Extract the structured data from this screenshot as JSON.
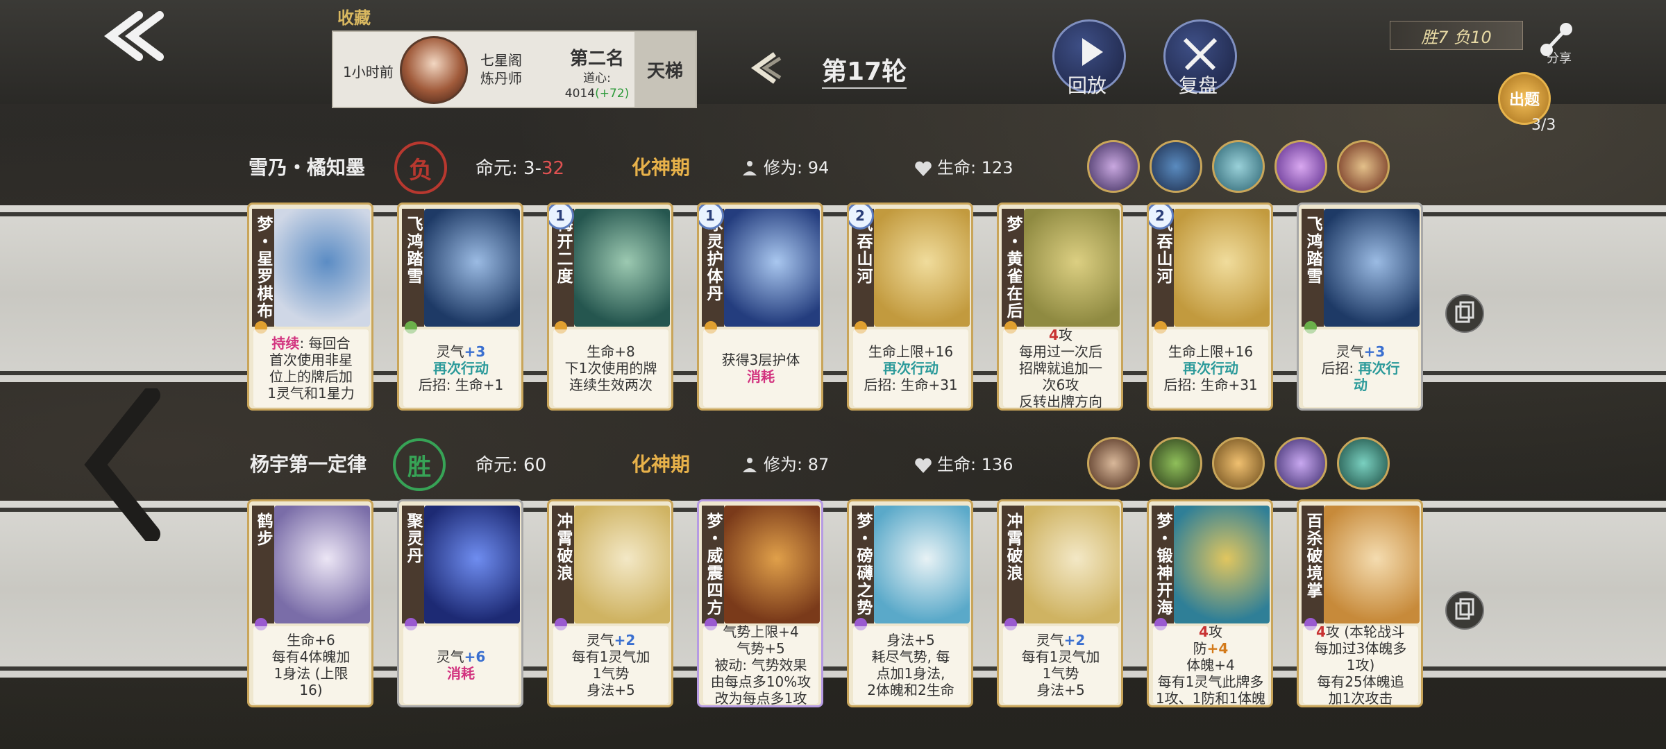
{
  "header": {
    "collect_label": "收藏",
    "record": {
      "time": "1小时前",
      "sect": "七星阁",
      "title": "炼丹师",
      "rank": "第二名",
      "daoxin_label": "道心:",
      "daoxin_value": "4014",
      "daoxin_gain": "(+72)",
      "ladder": "天梯"
    },
    "round_label": "第17轮",
    "replay_label": "回放",
    "review_label": "复盘",
    "win_loss": "胜7 负10",
    "share_label": "分享",
    "quiz_label": "出题",
    "quiz_count": "3/3"
  },
  "players": [
    {
      "name": "雪乃・橘知墨",
      "result": "负",
      "life_label": "命元:",
      "life_value": "3-",
      "life_loss": "32",
      "realm": "化神期",
      "cultivation": "修为: 94",
      "hp": "生命: 123",
      "portraits": [
        "portrait-1",
        "portrait-2",
        "portrait-3",
        "portrait-4",
        "portrait-5"
      ],
      "cards": [
        {
          "title": "梦・星罗棋布",
          "level": "",
          "lines": [
            {
              "t": "持续",
              "c": "pink",
              "rest": ": 每回合"
            },
            {
              "t": "首次使用非星"
            },
            {
              "t": "位上的牌后加"
            },
            {
              "t": "1灵气和1星力"
            }
          ],
          "art": [
            "#cfd7e6",
            "#5b8cc4"
          ],
          "frame": "gold"
        },
        {
          "title": "飞鸿踏雪",
          "level": "",
          "lines": [
            {
              "t": "灵气",
              "rest2": "+3",
              "c2": "blue"
            },
            {
              "t": "再次行动",
              "c": "teal"
            },
            {
              "t": "后招: 生命+1"
            }
          ],
          "art": [
            "#1e3a66",
            "#9bbbe3"
          ],
          "frame": "gold"
        },
        {
          "title": "梅开二度",
          "level": "1",
          "lines": [
            {
              "t": "生命+8"
            },
            {
              "t": "下1次使用的牌"
            },
            {
              "t": "连续生效两次"
            }
          ],
          "art": [
            "#25564f",
            "#9cc9b1"
          ],
          "frame": "gold"
        },
        {
          "title": "冰灵护体丹",
          "level": "1",
          "lines": [
            {
              "t": "获得3层护体"
            },
            {
              "t": "消耗",
              "c": "pink"
            }
          ],
          "art": [
            "#243d7e",
            "#a9c7ef"
          ],
          "frame": "gold"
        },
        {
          "title": "气吞山河",
          "level": "2",
          "lines": [
            {
              "t": "生命上限+16"
            },
            {
              "t": "再次行动",
              "c": "teal"
            },
            {
              "t": "后招: 生命+31"
            }
          ],
          "art": [
            "#c29a3e",
            "#f0dc9c"
          ],
          "frame": "gold"
        },
        {
          "title": "梦・黄雀在后",
          "level": "",
          "lines": [
            {
              "t": "4",
              "c": "red",
              "rest": "攻"
            },
            {
              "t": "每用过一次后"
            },
            {
              "t": "招牌就追加一"
            },
            {
              "t": "次6攻"
            },
            {
              "t": "反转出牌方向"
            }
          ],
          "art": [
            "#8f8a41",
            "#dccf82"
          ],
          "frame": "gold"
        },
        {
          "title": "气吞山河",
          "level": "2",
          "lines": [
            {
              "t": "生命上限+16"
            },
            {
              "t": "再次行动",
              "c": "teal"
            },
            {
              "t": "后招: 生命+31"
            }
          ],
          "art": [
            "#c29a3e",
            "#f0dc9c"
          ],
          "frame": "gold"
        },
        {
          "title": "飞鸿踏雪",
          "level": "",
          "lines": [
            {
              "t": "灵气",
              "rest2": "+3",
              "c2": "blue"
            },
            {
              "t": "后招: ",
              "rest2": "再次行",
              "c2": "teal"
            },
            {
              "t": "动",
              "c": "teal"
            }
          ],
          "art": [
            "#1e3a66",
            "#9bbbe3"
          ],
          "frame": "silver"
        }
      ]
    },
    {
      "name": "杨宇第一定律",
      "result": "胜",
      "life_label": "命元:",
      "life_value": "60",
      "life_loss": "",
      "realm": "化神期",
      "cultivation": "修为: 87",
      "hp": "生命: 136",
      "portraits": [
        "portrait-6",
        "portrait-7",
        "portrait-8",
        "portrait-9",
        "portrait-10"
      ],
      "cards": [
        {
          "title": "鹤步",
          "level": "",
          "lines": [
            {
              "t": "生命+6"
            },
            {
              "t": "每有4体魄加"
            },
            {
              "t": "1身法 (上限"
            },
            {
              "t": "16)"
            }
          ],
          "art": [
            "#7a6da8",
            "#ece6f5"
          ],
          "frame": "gold"
        },
        {
          "title": "聚灵丹",
          "level": "",
          "lines": [
            {
              "t": "灵气",
              "rest2": "+6",
              "c2": "blue"
            },
            {
              "t": "消耗",
              "c": "pink"
            }
          ],
          "art": [
            "#1d2a74",
            "#6f8df0"
          ],
          "frame": "silver"
        },
        {
          "title": "冲霄破浪",
          "level": "",
          "lines": [
            {
              "t": "灵气",
              "rest2": "+2",
              "c2": "blue"
            },
            {
              "t": "每有1灵气加"
            },
            {
              "t": "1气势"
            },
            {
              "t": "身法+5"
            }
          ],
          "art": [
            "#cfb362",
            "#f3e8c6"
          ],
          "frame": "gold"
        },
        {
          "title": "梦・威震四方",
          "level": "",
          "lines": [
            {
              "t": "气势上限+4"
            },
            {
              "t": "气势+5"
            },
            {
              "t": "被动: 气势效果"
            },
            {
              "t": "由每点多10%攻"
            },
            {
              "t": "改为每点多1攻"
            }
          ],
          "art": [
            "#7a3a1a",
            "#e0a04a"
          ],
          "frame": "purple"
        },
        {
          "title": "梦・磅礴之势",
          "level": "",
          "lines": [
            {
              "t": "身法+5"
            },
            {
              "t": "耗尽气势, 每"
            },
            {
              "t": "点加1身法,"
            },
            {
              "t": "2体魄和2生命"
            }
          ],
          "art": [
            "#5aa9c9",
            "#e8f2f5"
          ],
          "frame": "gold"
        },
        {
          "title": "冲霄破浪",
          "level": "",
          "lines": [
            {
              "t": "灵气",
              "rest2": "+2",
              "c2": "blue"
            },
            {
              "t": "每有1灵气加"
            },
            {
              "t": "1气势"
            },
            {
              "t": "身法+5"
            }
          ],
          "art": [
            "#cfb362",
            "#f3e8c6"
          ],
          "frame": "gold"
        },
        {
          "title": "梦・锻神开海",
          "level": "",
          "lines": [
            {
              "t": "4",
              "c": "red",
              "rest": "攻"
            },
            {
              "t": "防",
              "rest2": "+4",
              "c2": "orange"
            },
            {
              "t": "体魄+4"
            },
            {
              "t": "每有1灵气此牌多"
            },
            {
              "t": "1攻、1防和1体魄"
            }
          ],
          "art": [
            "#2f7f97",
            "#e1c65f"
          ],
          "frame": "gold"
        },
        {
          "title": "百杀破境掌",
          "level": "",
          "lines": [
            {
              "t": "4",
              "c": "red",
              "rest": "攻 (本轮战斗"
            },
            {
              "t": "每加过3体魄多"
            },
            {
              "t": "1攻)"
            },
            {
              "t": "每有25体魄追"
            },
            {
              "t": "加1次攻击"
            }
          ],
          "art": [
            "#c78a3a",
            "#f4dcb0"
          ],
          "frame": "gold"
        }
      ]
    }
  ],
  "colors": {
    "accent_gold": "#e8b24a",
    "lose_red": "#b8382f",
    "win_green": "#37a356"
  }
}
